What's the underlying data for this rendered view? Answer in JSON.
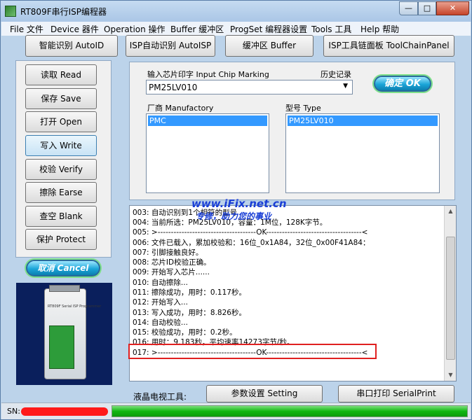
{
  "window": {
    "title": "RT809F串行ISP编程器",
    "min_glyph": "—",
    "max_glyph": "□",
    "close_glyph": "✕"
  },
  "menu": [
    {
      "label": "File 文件"
    },
    {
      "label": "Device 器件"
    },
    {
      "label": "Operation 操作"
    },
    {
      "label": "Buffer 缓冲区"
    },
    {
      "label": "ProgSet 编程器设置"
    },
    {
      "label": "Tools 工具"
    },
    {
      "label": "Help 帮助"
    }
  ],
  "toolbar": {
    "auto_id": "智能识别 AutoID",
    "isp_auto": "ISP自动识别 AutoISP",
    "buffer": "缓冲区 Buffer",
    "toolchain": "ISP工具链面板 ToolChainPanel"
  },
  "actions": {
    "read": "读取 Read",
    "save": "保存 Save",
    "open": "打开 Open",
    "write": "写入 Write",
    "verify": "校验 Verify",
    "erase": "擦除 Earse",
    "blank": "查空 Blank",
    "protect": "保护 Protect"
  },
  "cancel_label": "取消 Cancel",
  "chip": {
    "marking_label": "输入芯片印字 Input Chip Marking",
    "history_label": "历史记录",
    "marking_value": "PM25LV010",
    "ok_label": "确定 OK",
    "manufactory_label": "厂商 Manufactory",
    "type_label": "型号 Type",
    "manufactory_selected": "PMC",
    "type_selected": "PM25LV010"
  },
  "log": [
    "003: 自动识别到1个相符的型号",
    "004: 当前所选：PM25LV010，容量：1M位，128K字节。",
    "005: >-------------------------------------OK------------------------------------<",
    "006: 文件已载入，累加校验和：16位_0x1A84，32位_0x00F41A84：",
    "007: 引脚接触良好。",
    "008: 芯片ID校验正确。",
    "009: 开始写入芯片......",
    "010: 自动擦除...",
    "011: 擦除成功，用时：0.117秒。",
    "012: 开始写入...",
    "013: 写入成功，用时：8.826秒。",
    "014: 自动校验...",
    "015: 校验成功，用时：0.2秒。",
    "016: 用时：9.183秒，平均速率14273字节/秒。",
    "017: >-------------------------------------OK------------------------------------<"
  ],
  "watermark": {
    "url": "www.iFix.net.cn",
    "slogan": "专修，助力您的事业"
  },
  "bottom": {
    "lcd_label": "液晶电视工具:",
    "setting": "参数设置 Setting",
    "serial_print": "串口打印 SerialPrint"
  },
  "status": {
    "sn_label": "SN:",
    "progress_percent": 100
  },
  "colors": {
    "selection": "#3399ff",
    "highlight": "#e02020",
    "progress": "#11b711",
    "watermark": "#1a3fd6"
  },
  "photo": {
    "device_caption": "RT809F Serial ISP Programmer"
  }
}
